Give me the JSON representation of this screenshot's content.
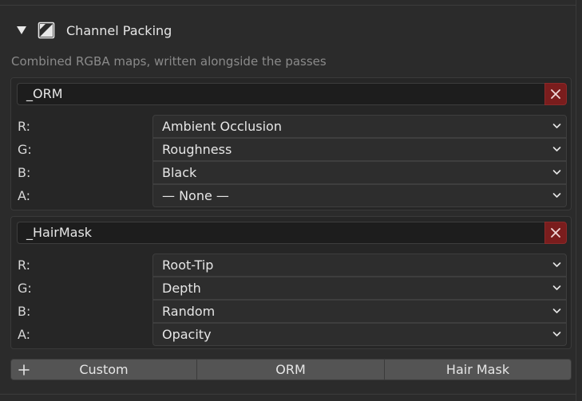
{
  "section": {
    "title": "Channel Packing",
    "description": "Combined RGBA maps, written alongside the passes",
    "icons": {
      "collapse": "triangle-down-icon",
      "header": "image-split-icon"
    }
  },
  "maps": [
    {
      "suffix": "_ORM",
      "remove_icon": "close-icon",
      "channels": [
        {
          "label": "R:",
          "value": "Ambient Occlusion"
        },
        {
          "label": "G:",
          "value": "Roughness"
        },
        {
          "label": "B:",
          "value": "Black"
        },
        {
          "label": "A:",
          "value": "— None —"
        }
      ]
    },
    {
      "suffix": "_HairMask",
      "remove_icon": "close-icon",
      "channels": [
        {
          "label": "R:",
          "value": "Root-Tip"
        },
        {
          "label": "G:",
          "value": "Depth"
        },
        {
          "label": "B:",
          "value": "Random"
        },
        {
          "label": "A:",
          "value": "Opacity"
        }
      ]
    }
  ],
  "presets": {
    "add_icon": "plus-icon",
    "buttons": [
      {
        "label": "Custom"
      },
      {
        "label": "ORM"
      },
      {
        "label": "Hair Mask"
      }
    ]
  },
  "colors": {
    "background": "#2b2b2b",
    "box_background": "#262626",
    "field_background": "#1d1d1d",
    "dropdown_background": "#2d2d2d",
    "remove_button": "#7a1d1d",
    "preset_button": "#545454",
    "description_text": "#8a8a8a"
  }
}
